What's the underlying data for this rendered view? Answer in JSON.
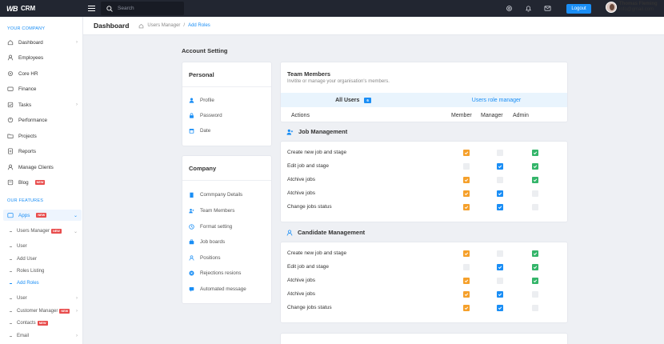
{
  "app": {
    "logo_mark": "WB",
    "name": "CRM"
  },
  "topbar": {
    "search_placeholder": "Search",
    "logout_label": "Logout",
    "user_name": "Thomas Fleming",
    "user_email": "info@gmail.com"
  },
  "sidebar": {
    "section_company": "YOUR COMPANY",
    "company_items": [
      {
        "label": "Dashboard",
        "icon": "home-icon"
      },
      {
        "label": "Employees",
        "icon": "user-icon"
      },
      {
        "label": "Core HR",
        "icon": "gear-icon"
      },
      {
        "label": "Finance",
        "icon": "wallet-icon"
      },
      {
        "label": "Tasks",
        "icon": "tasks-icon"
      },
      {
        "label": "Performance",
        "icon": "chart-icon"
      },
      {
        "label": "Projects",
        "icon": "folder-icon"
      },
      {
        "label": "Reports",
        "icon": "report-icon"
      },
      {
        "label": "Manage Clients",
        "icon": "clients-icon"
      },
      {
        "label": "Blog",
        "icon": "blog-icon",
        "badge": "NEW"
      }
    ],
    "section_features": "OUR FEATURES",
    "apps_label": "Apps",
    "apps_badge": "NEW",
    "users_manager_label": "Users Manager",
    "users_manager_badge": "NEW",
    "sub_items": [
      "User",
      "Add User",
      "Roles Listing",
      "Add Roles"
    ],
    "other_items": [
      {
        "label": "User"
      },
      {
        "label": "Customer Manager",
        "badge": "NEW"
      },
      {
        "label": "Contacts",
        "badge": "NEW"
      },
      {
        "label": "Email"
      }
    ]
  },
  "header": {
    "title": "Dashboard",
    "breadcrumb": [
      "Users Manager",
      "/",
      "Add Roles"
    ]
  },
  "account": {
    "title": "Account Setting",
    "personal_title": "Personal",
    "personal_links": [
      {
        "label": "Profile",
        "icon": "user-icon"
      },
      {
        "label": "Password",
        "icon": "lock-icon"
      },
      {
        "label": "Date",
        "icon": "calendar-icon"
      }
    ],
    "company_title": "Company",
    "company_links": [
      {
        "label": "Commpany Details",
        "icon": "building-icon"
      },
      {
        "label": "Team Members",
        "icon": "team-icon"
      },
      {
        "label": "Format setting",
        "icon": "clock-icon"
      },
      {
        "label": "Job boards",
        "icon": "briefcase-icon"
      },
      {
        "label": "Positions",
        "icon": "user-icon"
      },
      {
        "label": "Rejections resions",
        "icon": "close-circle-icon"
      },
      {
        "label": "Automated message",
        "icon": "message-icon"
      }
    ]
  },
  "team": {
    "title": "Team Members",
    "subtitle": "Invitite or manage your organisation's members.",
    "tab_all": "All Users",
    "tab_all_count": "6",
    "tab_roles": "Users role manager",
    "col_actions": "Actions",
    "col_member": "Member",
    "col_manager": "Manager",
    "col_admin": "Admin",
    "groups": [
      {
        "title": "Job Management",
        "icon": "add-user-icon",
        "rows": [
          {
            "label": "Create new job and stage",
            "member": true,
            "manager": false,
            "admin": true
          },
          {
            "label": "Edit job and stage",
            "member": false,
            "manager": true,
            "admin": true
          },
          {
            "label": "Atchive jobs",
            "member": true,
            "manager": false,
            "admin": true
          },
          {
            "label": "Atchive jobs",
            "member": true,
            "manager": true,
            "admin": false
          },
          {
            "label": "Change jobs status",
            "member": true,
            "manager": true,
            "admin": false
          }
        ]
      },
      {
        "title": "Candidate Management",
        "icon": "user-icon",
        "rows": [
          {
            "label": "Create new job and stage",
            "member": true,
            "manager": false,
            "admin": true
          },
          {
            "label": "Edit job and stage",
            "member": false,
            "manager": true,
            "admin": true
          },
          {
            "label": "Atchive jobs",
            "member": true,
            "manager": false,
            "admin": true
          },
          {
            "label": "Atchive jobs",
            "member": true,
            "manager": true,
            "admin": false
          },
          {
            "label": "Change jobs status",
            "member": true,
            "manager": true,
            "admin": false
          }
        ]
      }
    ]
  },
  "colors": {
    "accent": "#1a8ef5",
    "member": "#f5a02b",
    "manager": "#1a8ef5",
    "admin": "#34b56a",
    "topbar": "#222631"
  }
}
